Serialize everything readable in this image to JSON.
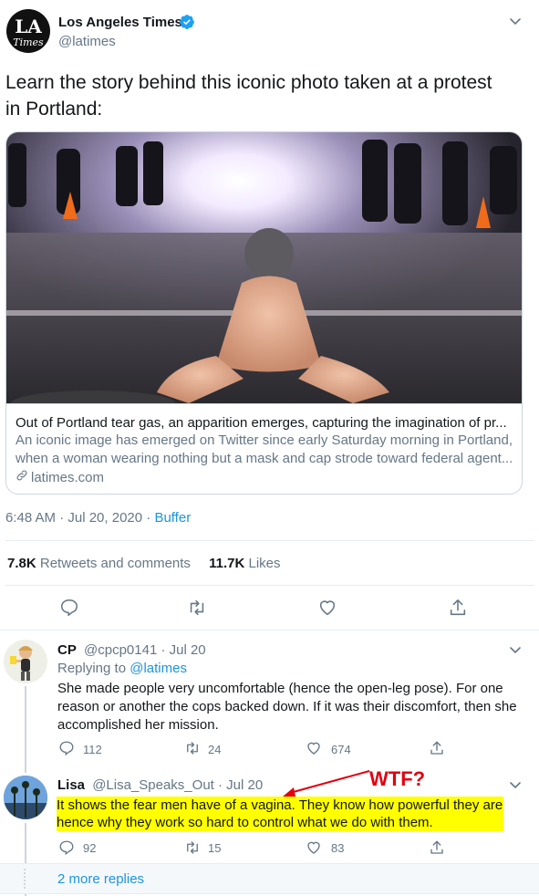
{
  "tweet": {
    "author_name": "Los Angeles Times",
    "author_handle": "@latimes",
    "logo_text": "LA Times",
    "text": "Learn the story behind this iconic photo taken at a protest in Portland:",
    "card": {
      "title": "Out of Portland tear gas, an apparition emerges, capturing the imagination of pr...",
      "description": "An iconic image has emerged on Twitter since early Saturday morning in Portland, when a woman wearing nothing but a mask and cap strode toward federal agent...",
      "domain": "latimes.com"
    },
    "timestamp": "6:48 AM · Jul 20, 2020 · ",
    "source": "Buffer",
    "retweets_count": "7.8K",
    "retweets_label": " Retweets and comments",
    "likes_count": "11.7K",
    "likes_label": " Likes"
  },
  "replies": [
    {
      "name": "CP",
      "handle_date": "@cpcp0141 · Jul 20",
      "replying_prefix": "Replying to ",
      "replying_to": "@latimes",
      "text": "She made people very uncomfortable (hence the open-leg pose). For one reason or another the cops backed down. If it was their discomfort, then she accomplished her mission.",
      "comments": "112",
      "retweets": "24",
      "likes": "674"
    },
    {
      "name": "Lisa",
      "handle_date": "@Lisa_Speaks_Out · Jul 20",
      "text": "It shows the fear men have of a vagina. They know how powerful they are hence why they work so hard to control what we do with them.",
      "comments": "92",
      "retweets": "15",
      "likes": "83"
    }
  ],
  "annotation": {
    "text": "WTF?",
    "color": "#e3000f"
  },
  "more_replies": "2 more replies",
  "colors": {
    "highlight": "#ffff00",
    "link": "#1b95e0",
    "verified": "#1da1f2"
  }
}
